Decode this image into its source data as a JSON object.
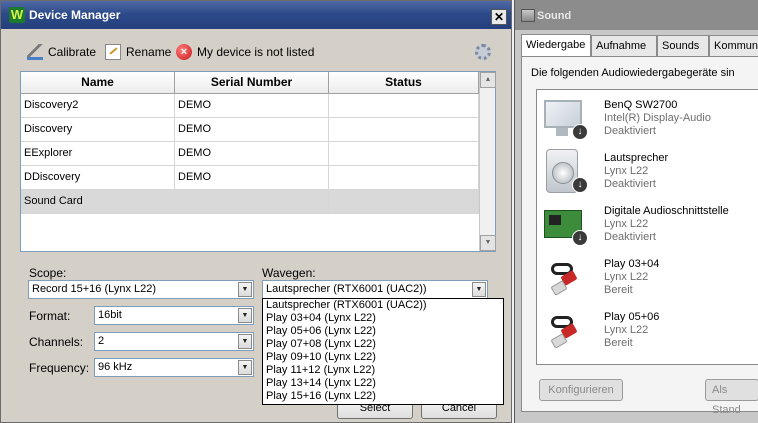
{
  "device_manager": {
    "title": "Device Manager",
    "close_glyph": "✕",
    "toolbar": {
      "calibrate": "Calibrate",
      "rename": "Rename",
      "not_listed": "My device is not listed"
    },
    "table": {
      "columns": [
        "Name",
        "Serial Number",
        "Status"
      ],
      "rows": [
        {
          "name": "Discovery2",
          "serial": "DEMO",
          "status": ""
        },
        {
          "name": "Discovery",
          "serial": "DEMO",
          "status": ""
        },
        {
          "name": "EExplorer",
          "serial": "DEMO",
          "status": ""
        },
        {
          "name": "DDiscovery",
          "serial": "DEMO",
          "status": ""
        },
        {
          "name": "Sound Card",
          "serial": "",
          "status": ""
        }
      ],
      "selected_row": "Sound Card"
    },
    "scope": {
      "label": "Scope:",
      "value": "Record 15+16 (Lynx L22)"
    },
    "wavegen": {
      "label": "Wavegen:",
      "value": "Lautsprecher (RTX6001 (UAC2))",
      "options": [
        "Lautsprecher (RTX6001 (UAC2))",
        "Play 03+04 (Lynx L22)",
        "Play 05+06 (Lynx L22)",
        "Play 07+08 (Lynx L22)",
        "Play 09+10 (Lynx L22)",
        "Play 11+12 (Lynx L22)",
        "Play 13+14 (Lynx L22)",
        "Play 15+16 (Lynx L22)"
      ]
    },
    "format": {
      "label": "Format:",
      "value": "16bit"
    },
    "channels": {
      "label": "Channels:",
      "value": "2"
    },
    "frequency": {
      "label": "Frequency:",
      "value": "96 kHz"
    },
    "buttons": {
      "select": "Select",
      "cancel": "Cancel"
    }
  },
  "sound": {
    "title": "Sound",
    "tabs": [
      "Wiedergabe",
      "Aufnahme",
      "Sounds",
      "Kommunika"
    ],
    "active_tab": "Wiedergabe",
    "description": "Die folgenden Audiowiedergabegeräte sin",
    "devices": [
      {
        "name": "BenQ SW2700",
        "detail": "Intel(R) Display-Audio",
        "state": "Deaktiviert",
        "icon": "monitor-icon"
      },
      {
        "name": "Lautsprecher",
        "detail": "Lynx L22",
        "state": "Deaktiviert",
        "icon": "speaker-icon"
      },
      {
        "name": "Digitale Audioschnittstelle",
        "detail": "Lynx L22",
        "state": "Deaktiviert",
        "icon": "sound-card-icon"
      },
      {
        "name": "Play 03+04",
        "detail": "Lynx L22",
        "state": "Bereit",
        "icon": "rca-cable-icon"
      },
      {
        "name": "Play 05+06",
        "detail": "Lynx L22",
        "state": "Bereit",
        "icon": "rca-cable-icon"
      }
    ],
    "buttons": {
      "configure": "Konfigurieren",
      "as_default": "Als Stand"
    }
  }
}
